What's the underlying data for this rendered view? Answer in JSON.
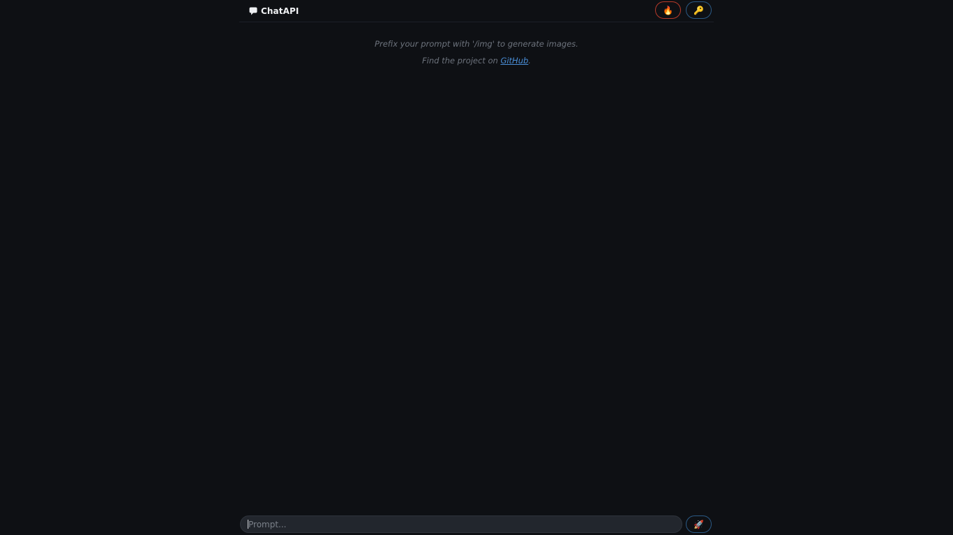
{
  "header": {
    "title": "ChatAPI",
    "brand_icon": "speech-bubble-icon",
    "buttons": [
      {
        "icon": "fire-icon",
        "glyph": "🔥",
        "accent": "#b83a2a"
      },
      {
        "icon": "key-icon",
        "glyph": "🔑",
        "accent": "#2b5a86"
      }
    ]
  },
  "intro": {
    "line1": "Prefix your prompt with '/img' to generate images.",
    "line2_prefix": "Find the project on ",
    "line2_link": "GitHub",
    "line2_suffix": "."
  },
  "composer": {
    "placeholder": "Prompt...",
    "value": "",
    "send_icon": "rocket-icon",
    "send_glyph": "🚀"
  },
  "colors": {
    "background": "#0e1014",
    "link": "#4a8fd8",
    "muted_text": "#6d737d"
  }
}
